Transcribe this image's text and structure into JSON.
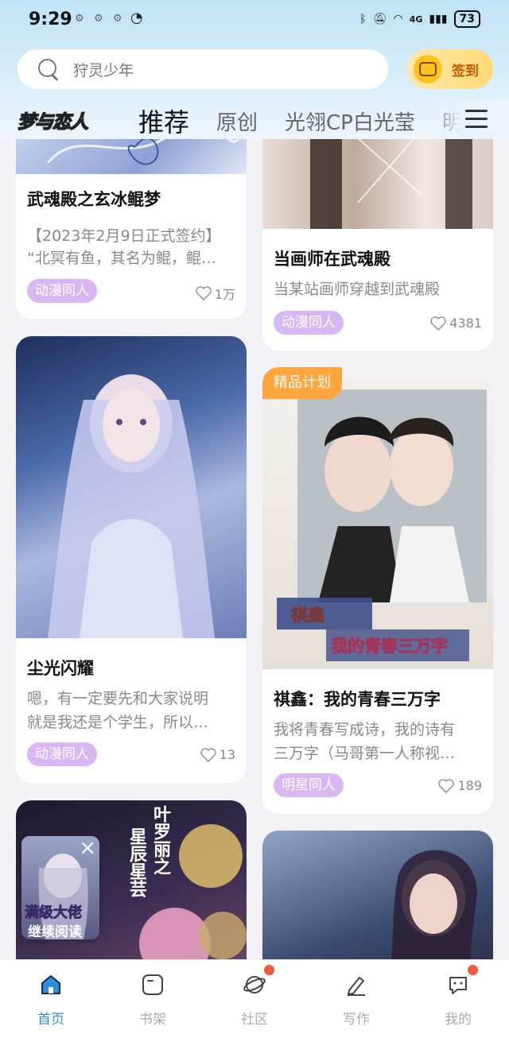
{
  "status_bar": {
    "time": "9:29",
    "network": "4G",
    "battery": "73"
  },
  "search": {
    "placeholder": "狩灵少年"
  },
  "signin": {
    "label": "签到"
  },
  "tabs": {
    "logo": "梦与恋人",
    "items": [
      "推荐",
      "原创",
      "光翎CP白光莹",
      "明"
    ]
  },
  "feed": {
    "cards": [
      {
        "title": "武魂殿之玄冰鲲梦",
        "desc_lines": [
          "【2023年2月9日正式签约】",
          "“北冥有鱼，其名为鲲，鲲…"
        ],
        "tag": "动漫同人",
        "likes": "1万"
      },
      {
        "title": "当画师在武魂殿",
        "desc_lines": [
          "当某站画师穿越到武魂殿"
        ],
        "tag": "动漫同人",
        "likes": "4381"
      },
      {
        "title": "尘光闪耀",
        "desc_lines": [
          "嗯，有一定要先和大家说明",
          "就是我还是个学生，所以…"
        ],
        "tag": "动漫同人",
        "likes": "13"
      },
      {
        "badge": "精品计划",
        "title": "祺鑫：我的青春三万字",
        "cover_text": [
          "祺鑫",
          "我的青春三万字"
        ],
        "desc_lines": [
          "我将青春写成诗，我的诗有",
          "三万字（马哥第一人称视…"
        ],
        "tag": "明星同人",
        "likes": "189"
      },
      {
        "cover_text": [
          "叶罗丽之",
          "星辰星芸"
        ]
      },
      {}
    ]
  },
  "continue_reading": {
    "cover_title": "满级大佬",
    "label": "继续阅读"
  },
  "bottom_nav": {
    "items": [
      "首页",
      "书架",
      "社区",
      "写作",
      "我的"
    ]
  },
  "colors": {
    "accent": "#2a8de0",
    "tag_bg": "#d9b7f3",
    "badge_bg": "#ffa53d",
    "dot": "#ec5a3c"
  }
}
